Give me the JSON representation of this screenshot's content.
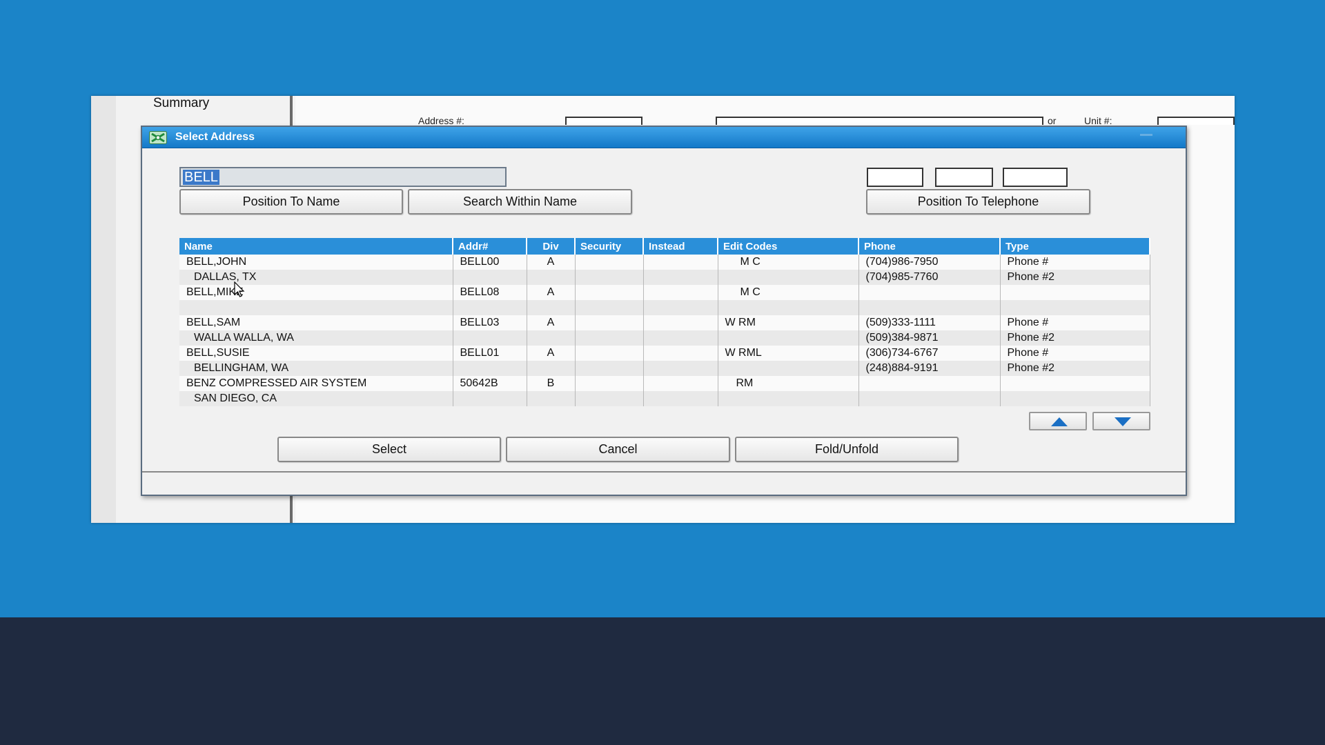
{
  "background_app": {
    "sidebar_label": "Summary",
    "address_label": "Address #:",
    "or_label": "or",
    "unit_label": "Unit #:"
  },
  "dialog": {
    "title": "Select Address",
    "search_value": "BELL",
    "buttons": {
      "position_to_name": "Position To Name",
      "search_within_name": "Search Within Name",
      "position_to_telephone": "Position To Telephone",
      "select": "Select",
      "cancel": "Cancel",
      "fold_unfold": "Fold/Unfold"
    },
    "columns": [
      "Name",
      "Addr#",
      "Div",
      "Security",
      "Instead",
      "Edit Codes",
      "Phone",
      "Type"
    ],
    "rows": [
      {
        "name": "BELL,JOHN",
        "addr": "BELL00",
        "div": "A",
        "security": "",
        "instead": "",
        "codes": "M C",
        "phone": "(704)986-7950",
        "type": "Phone #"
      },
      {
        "name": "DALLAS, TX",
        "addr": "",
        "div": "",
        "security": "",
        "instead": "",
        "codes": "",
        "phone": "(704)985-7760",
        "type": "Phone #2"
      },
      {
        "name": "BELL,MIKE",
        "addr": "BELL08",
        "div": "A",
        "security": "",
        "instead": "",
        "codes": "M C",
        "phone": "",
        "type": ""
      },
      {
        "name": "",
        "addr": "",
        "div": "",
        "security": "",
        "instead": "",
        "codes": "",
        "phone": "",
        "type": ""
      },
      {
        "name": "BELL,SAM",
        "addr": "BELL03",
        "div": "A",
        "security": "",
        "instead": "",
        "codes": "W  RM",
        "phone": "(509)333-1111",
        "type": "Phone #"
      },
      {
        "name": "WALLA WALLA, WA",
        "addr": "",
        "div": "",
        "security": "",
        "instead": "",
        "codes": "",
        "phone": "(509)384-9871",
        "type": "Phone #2"
      },
      {
        "name": "BELL,SUSIE",
        "addr": "BELL01",
        "div": "A",
        "security": "",
        "instead": "",
        "codes": "W  RML",
        "phone": "(306)734-6767",
        "type": "Phone #"
      },
      {
        "name": "BELLINGHAM, WA",
        "addr": "",
        "div": "",
        "security": "",
        "instead": "",
        "codes": "",
        "phone": "(248)884-9191",
        "type": "Phone #2"
      },
      {
        "name": "BENZ COMPRESSED AIR SYSTEM",
        "addr": "50642B",
        "div": "B",
        "security": "",
        "instead": "",
        "codes": "RM",
        "phone": "",
        "type": ""
      },
      {
        "name": "SAN DIEGO, CA",
        "addr": "",
        "div": "",
        "security": "",
        "instead": "",
        "codes": "",
        "phone": "",
        "type": ""
      }
    ]
  },
  "colors": {
    "desktop": "#1b84c8",
    "footer": "#1f2a40",
    "header": "#2a8fd9",
    "selection": "#3b79c9"
  },
  "icons": [
    "app-icon",
    "arrow-up-icon",
    "arrow-down-icon",
    "mouse-cursor-icon"
  ]
}
